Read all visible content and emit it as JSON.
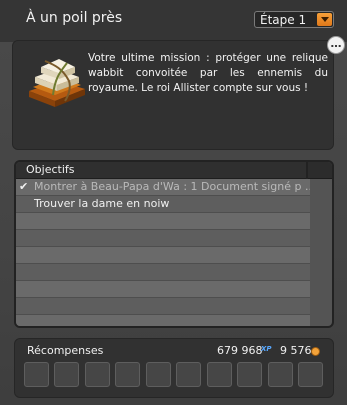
{
  "window": {
    "title": "À un poil près",
    "more_label": "…"
  },
  "step_select": {
    "selected": "Étape 1"
  },
  "intro": {
    "relic_icon": "relic-book-icon",
    "text": "Votre ultime mission : protéger une relique wabbit convoitée par les ennemis du royaume. Le roi Allister compte sur vous !"
  },
  "objectives": {
    "header": "Objectifs",
    "items": [
      {
        "check": "✔",
        "label": "Montrer à Beau-Papa d'Wa : 1 Document signé p ..."
      },
      {
        "check": "",
        "label": "Trouver la dame en noiw"
      },
      {
        "check": "",
        "label": ""
      },
      {
        "check": "",
        "label": ""
      },
      {
        "check": "",
        "label": ""
      },
      {
        "check": "",
        "label": ""
      },
      {
        "check": "",
        "label": ""
      },
      {
        "check": "",
        "label": ""
      },
      {
        "check": "",
        "label": ""
      }
    ]
  },
  "rewards": {
    "label": "Récompenses",
    "xp": "679 968",
    "xp_unit": "XP",
    "kamas": "9 576",
    "kamas_icon": "kamas-coin-icon",
    "slot_count": 10
  },
  "colors": {
    "accent": "#e8821f",
    "xp_blue": "#58a8ff"
  }
}
